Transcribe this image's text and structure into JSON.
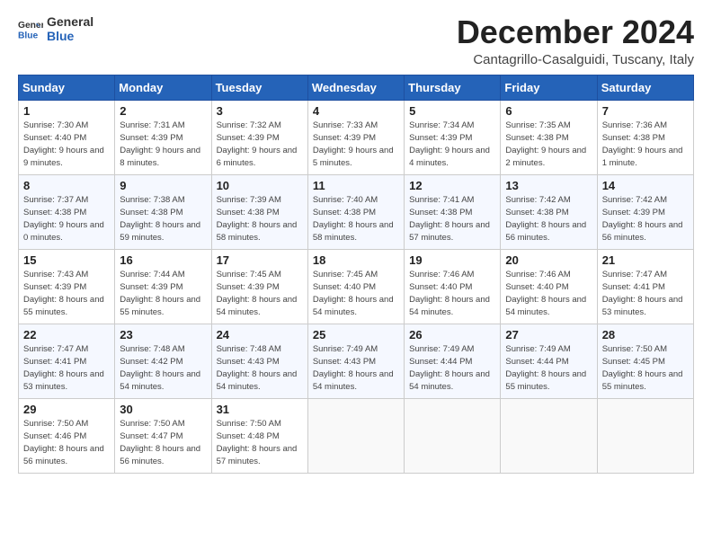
{
  "logo": {
    "line1": "General",
    "line2": "Blue"
  },
  "title": "December 2024",
  "subtitle": "Cantagrillo-Casalguidi, Tuscany, Italy",
  "weekdays": [
    "Sunday",
    "Monday",
    "Tuesday",
    "Wednesday",
    "Thursday",
    "Friday",
    "Saturday"
  ],
  "weeks": [
    [
      {
        "day": "1",
        "rise": "7:30 AM",
        "set": "4:40 PM",
        "daylight": "9 hours and 9 minutes."
      },
      {
        "day": "2",
        "rise": "7:31 AM",
        "set": "4:39 PM",
        "daylight": "9 hours and 8 minutes."
      },
      {
        "day": "3",
        "rise": "7:32 AM",
        "set": "4:39 PM",
        "daylight": "9 hours and 6 minutes."
      },
      {
        "day": "4",
        "rise": "7:33 AM",
        "set": "4:39 PM",
        "daylight": "9 hours and 5 minutes."
      },
      {
        "day": "5",
        "rise": "7:34 AM",
        "set": "4:39 PM",
        "daylight": "9 hours and 4 minutes."
      },
      {
        "day": "6",
        "rise": "7:35 AM",
        "set": "4:38 PM",
        "daylight": "9 hours and 2 minutes."
      },
      {
        "day": "7",
        "rise": "7:36 AM",
        "set": "4:38 PM",
        "daylight": "9 hours and 1 minute."
      }
    ],
    [
      {
        "day": "8",
        "rise": "7:37 AM",
        "set": "4:38 PM",
        "daylight": "9 hours and 0 minutes."
      },
      {
        "day": "9",
        "rise": "7:38 AM",
        "set": "4:38 PM",
        "daylight": "8 hours and 59 minutes."
      },
      {
        "day": "10",
        "rise": "7:39 AM",
        "set": "4:38 PM",
        "daylight": "8 hours and 58 minutes."
      },
      {
        "day": "11",
        "rise": "7:40 AM",
        "set": "4:38 PM",
        "daylight": "8 hours and 58 minutes."
      },
      {
        "day": "12",
        "rise": "7:41 AM",
        "set": "4:38 PM",
        "daylight": "8 hours and 57 minutes."
      },
      {
        "day": "13",
        "rise": "7:42 AM",
        "set": "4:38 PM",
        "daylight": "8 hours and 56 minutes."
      },
      {
        "day": "14",
        "rise": "7:42 AM",
        "set": "4:39 PM",
        "daylight": "8 hours and 56 minutes."
      }
    ],
    [
      {
        "day": "15",
        "rise": "7:43 AM",
        "set": "4:39 PM",
        "daylight": "8 hours and 55 minutes."
      },
      {
        "day": "16",
        "rise": "7:44 AM",
        "set": "4:39 PM",
        "daylight": "8 hours and 55 minutes."
      },
      {
        "day": "17",
        "rise": "7:45 AM",
        "set": "4:39 PM",
        "daylight": "8 hours and 54 minutes."
      },
      {
        "day": "18",
        "rise": "7:45 AM",
        "set": "4:40 PM",
        "daylight": "8 hours and 54 minutes."
      },
      {
        "day": "19",
        "rise": "7:46 AM",
        "set": "4:40 PM",
        "daylight": "8 hours and 54 minutes."
      },
      {
        "day": "20",
        "rise": "7:46 AM",
        "set": "4:40 PM",
        "daylight": "8 hours and 54 minutes."
      },
      {
        "day": "21",
        "rise": "7:47 AM",
        "set": "4:41 PM",
        "daylight": "8 hours and 53 minutes."
      }
    ],
    [
      {
        "day": "22",
        "rise": "7:47 AM",
        "set": "4:41 PM",
        "daylight": "8 hours and 53 minutes."
      },
      {
        "day": "23",
        "rise": "7:48 AM",
        "set": "4:42 PM",
        "daylight": "8 hours and 54 minutes."
      },
      {
        "day": "24",
        "rise": "7:48 AM",
        "set": "4:43 PM",
        "daylight": "8 hours and 54 minutes."
      },
      {
        "day": "25",
        "rise": "7:49 AM",
        "set": "4:43 PM",
        "daylight": "8 hours and 54 minutes."
      },
      {
        "day": "26",
        "rise": "7:49 AM",
        "set": "4:44 PM",
        "daylight": "8 hours and 54 minutes."
      },
      {
        "day": "27",
        "rise": "7:49 AM",
        "set": "4:44 PM",
        "daylight": "8 hours and 55 minutes."
      },
      {
        "day": "28",
        "rise": "7:50 AM",
        "set": "4:45 PM",
        "daylight": "8 hours and 55 minutes."
      }
    ],
    [
      {
        "day": "29",
        "rise": "7:50 AM",
        "set": "4:46 PM",
        "daylight": "8 hours and 56 minutes."
      },
      {
        "day": "30",
        "rise": "7:50 AM",
        "set": "4:47 PM",
        "daylight": "8 hours and 56 minutes."
      },
      {
        "day": "31",
        "rise": "7:50 AM",
        "set": "4:48 PM",
        "daylight": "8 hours and 57 minutes."
      },
      null,
      null,
      null,
      null
    ]
  ]
}
